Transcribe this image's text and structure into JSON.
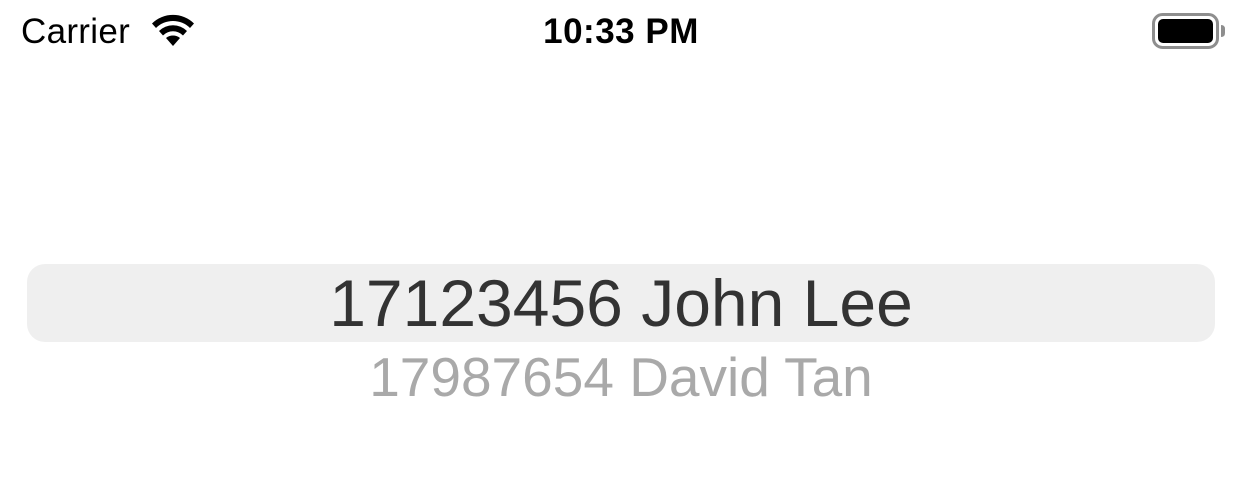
{
  "status_bar": {
    "carrier": "Carrier",
    "time": "10:33 PM",
    "wifi_icon": "wifi-icon",
    "battery_icon": "battery-full-icon"
  },
  "picker": {
    "rows": [
      {
        "label": "17123456 John Lee",
        "selected": true
      },
      {
        "label": "17987654 David Tan",
        "selected": false
      }
    ],
    "selection_color": "#efefef",
    "selected_text_color": "#333333",
    "unselected_text_color": "#a9a9a9"
  }
}
